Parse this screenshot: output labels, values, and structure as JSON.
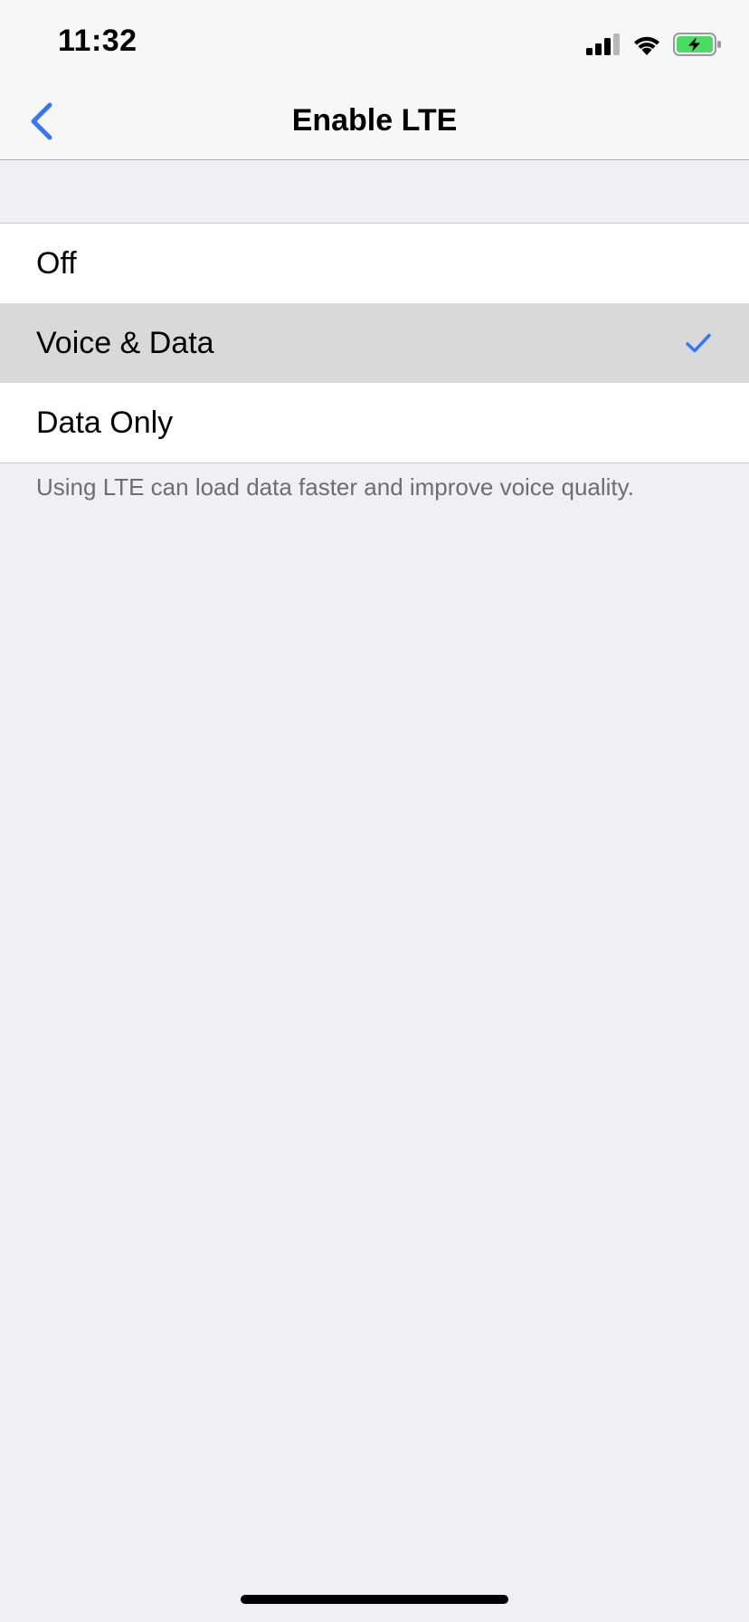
{
  "status_bar": {
    "time": "11:32",
    "icons": [
      "signal-icon",
      "wifi-icon",
      "battery-charging-icon"
    ],
    "battery_color": "#4cd964"
  },
  "nav": {
    "back_icon": "chevron-left-icon",
    "title": "Enable LTE",
    "accent_color": "#3478f6"
  },
  "options": [
    {
      "label": "Off",
      "selected": false
    },
    {
      "label": "Voice & Data",
      "selected": true
    },
    {
      "label": "Data Only",
      "selected": false
    }
  ],
  "footer": {
    "note": "Using LTE can load data faster and improve voice quality."
  }
}
